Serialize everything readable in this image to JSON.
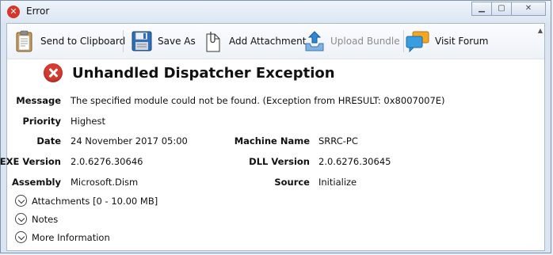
{
  "window": {
    "title": "Error",
    "colors": {
      "title_icon": "#d9342b",
      "error_icon": "#d73a31",
      "accent": "#1e7fd0"
    }
  },
  "toolbar": {
    "send_to_clipboard": "Send to Clipboard",
    "save_as": "Save As",
    "add_attachment": "Add Attachment",
    "upload_bundle": "Upload Bundle",
    "visit_forum": "Visit Forum"
  },
  "error": {
    "heading": "Unhandled Dispatcher Exception",
    "fields": {
      "message_label": "Message",
      "message": "The specified module could not be found. (Exception from HRESULT: 0x8007007E)",
      "priority_label": "Priority",
      "priority": "Highest",
      "date_label": "Date",
      "date": "24 November 2017 05:00",
      "machine_label": "Machine Name",
      "machine": "SRRC-PC",
      "exe_label": "EXE Version",
      "exe": "2.0.6276.30646",
      "dll_label": "DLL Version",
      "dll": "2.0.6276.30645",
      "assembly_label": "Assembly",
      "assembly": "Microsoft.Dism",
      "source_label": "Source",
      "source": "Initialize"
    }
  },
  "sections": {
    "attachments": "Attachments [0 - 10.00 MB]",
    "notes": "Notes",
    "more_information": "More Information"
  }
}
